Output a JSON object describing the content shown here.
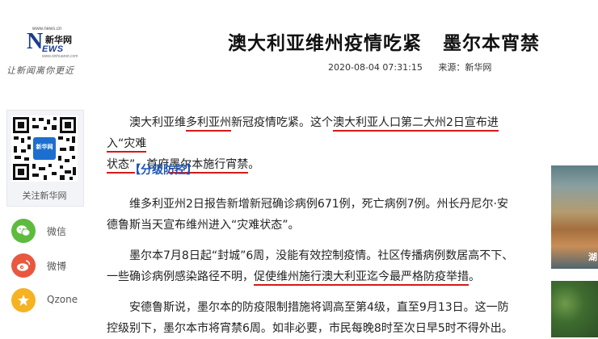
{
  "header": {
    "logo_url": "www.news.cn",
    "logo_letter": "N",
    "logo_cn": "新华网",
    "logo_ews": "EWS",
    "logo_sub": "www.xinhuanet.com",
    "slogan": "让新闻离你更近",
    "title_part1": "澳大利亚维州疫情吃紧",
    "title_part2": "墨尔本宵禁",
    "datetime": "2020-08-04 07:31:15",
    "source": "来源：新华网"
  },
  "sidebar": {
    "qr_badge": "新华网",
    "qr_caption": "关注新华网",
    "share": [
      {
        "label": "微信",
        "icon": "wechat-icon",
        "color": "#5dbb3d"
      },
      {
        "label": "微博",
        "icon": "weibo-icon",
        "color": "#e8583f"
      },
      {
        "label": "Qzone",
        "icon": "qzone-icon",
        "color": "#f5b322"
      }
    ]
  },
  "article": {
    "p1_a": "澳大利亚维",
    "p1_b": "多利亚州",
    "p1_c": "新冠疫情吃紧。这个",
    "p1_d": "澳大利亚人口第二大州2日宣布进入“灾难",
    "p1_e": "状态”",
    "p1_f": "，首府",
    "p1_g": "墨尔本施行宵禁",
    "p1_h": "。",
    "subhead": "【分级防控】",
    "p2": "维多利亚州2日报告新增新冠确诊病例671例，死亡病例7例。州长丹尼尔·安德鲁斯当天宣布维州进入“灾难状态”。",
    "p3_a": "墨尔本7月8日起“封城”6周，没能有效控制疫情。社区传播病例数居高不下、一些确诊病例感染路径不明，",
    "p3_b": "促使维州施行澳大利亚迄今最严格防疫举措",
    "p3_c": "。",
    "p4": "安德鲁斯说，墨尔本的防疫限制措施将调高至第4级，直至9月13日。这一防控级别下，墨尔本市将宵禁6周。如非必要，市民每晚8时至次日早5时不得外出。"
  },
  "right": {
    "img1_caption": "湖"
  },
  "colors": {
    "accent_underline": "#d21b1b",
    "subhead_blue": "#1d55b8",
    "logo_blue": "#1a3d8f"
  }
}
